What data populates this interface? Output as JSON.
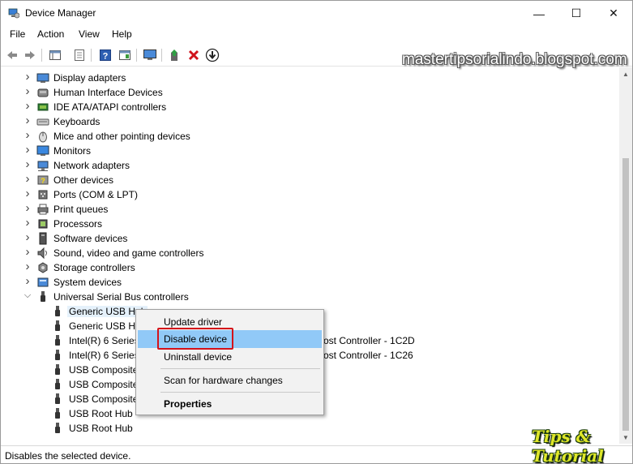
{
  "window": {
    "title": "Device Manager",
    "controls": {
      "minimize": "—",
      "maximize": "☐",
      "close": "✕"
    }
  },
  "menu": [
    "File",
    "Action",
    "View",
    "Help"
  ],
  "toolbar": {
    "icons": [
      "back-icon",
      "forward-icon",
      "show-hide-console-tree-icon",
      "properties-icon",
      "help-icon",
      "action-pane-icon",
      "monitor-icon",
      "update-driver-icon",
      "uninstall-icon",
      "enable-device-icon"
    ]
  },
  "tree": {
    "categories": [
      {
        "label": "Display adapters",
        "icon": "display-adapter-icon",
        "expanded": false
      },
      {
        "label": "Human Interface Devices",
        "icon": "hid-icon",
        "expanded": false
      },
      {
        "label": "IDE ATA/ATAPI controllers",
        "icon": "ide-controller-icon",
        "expanded": false
      },
      {
        "label": "Keyboards",
        "icon": "keyboard-icon",
        "expanded": false
      },
      {
        "label": "Mice and other pointing devices",
        "icon": "mouse-icon",
        "expanded": false
      },
      {
        "label": "Monitors",
        "icon": "monitor-icon",
        "expanded": false
      },
      {
        "label": "Network adapters",
        "icon": "network-adapter-icon",
        "expanded": false
      },
      {
        "label": "Other devices",
        "icon": "other-devices-icon",
        "expanded": false
      },
      {
        "label": "Ports (COM & LPT)",
        "icon": "port-icon",
        "expanded": false
      },
      {
        "label": "Print queues",
        "icon": "printer-icon",
        "expanded": false
      },
      {
        "label": "Processors",
        "icon": "processor-icon",
        "expanded": false
      },
      {
        "label": "Software devices",
        "icon": "software-device-icon",
        "expanded": false
      },
      {
        "label": "Sound, video and game controllers",
        "icon": "speaker-icon",
        "expanded": false
      },
      {
        "label": "Storage controllers",
        "icon": "storage-controller-icon",
        "expanded": false
      },
      {
        "label": "System devices",
        "icon": "system-device-icon",
        "expanded": false
      },
      {
        "label": "Universal Serial Bus controllers",
        "icon": "usb-icon",
        "expanded": true
      }
    ],
    "usb_children": [
      {
        "label": "Generic USB Hub",
        "selected": true
      },
      {
        "label": "Generic USB Hu",
        "selected": false
      },
      {
        "label": "Intel(R) 6 Series/",
        "tail": "ost Controller - 1C2D",
        "selected": false
      },
      {
        "label": "Intel(R) 6 Series/",
        "tail": "ost Controller - 1C26",
        "selected": false
      },
      {
        "label": "USB Composite",
        "selected": false
      },
      {
        "label": "USB Composite",
        "selected": false
      },
      {
        "label": "USB Composite",
        "selected": false
      },
      {
        "label": "USB Root Hub",
        "selected": false
      },
      {
        "label": "USB Root Hub",
        "selected": false
      }
    ]
  },
  "context_menu": {
    "update_driver": "Update driver",
    "disable_device": "Disable device",
    "uninstall_device": "Uninstall device",
    "scan": "Scan for hardware changes",
    "properties": "Properties"
  },
  "statusbar": {
    "text": "Disables the selected device."
  },
  "watermarks": {
    "site": "mastertipsorialindo.blogspot.com",
    "logo": "Tips & Tutorial"
  },
  "colors": {
    "highlight": "#91c9f7",
    "selection": "#e5f1fb",
    "annotation_box": "#d4121a"
  }
}
